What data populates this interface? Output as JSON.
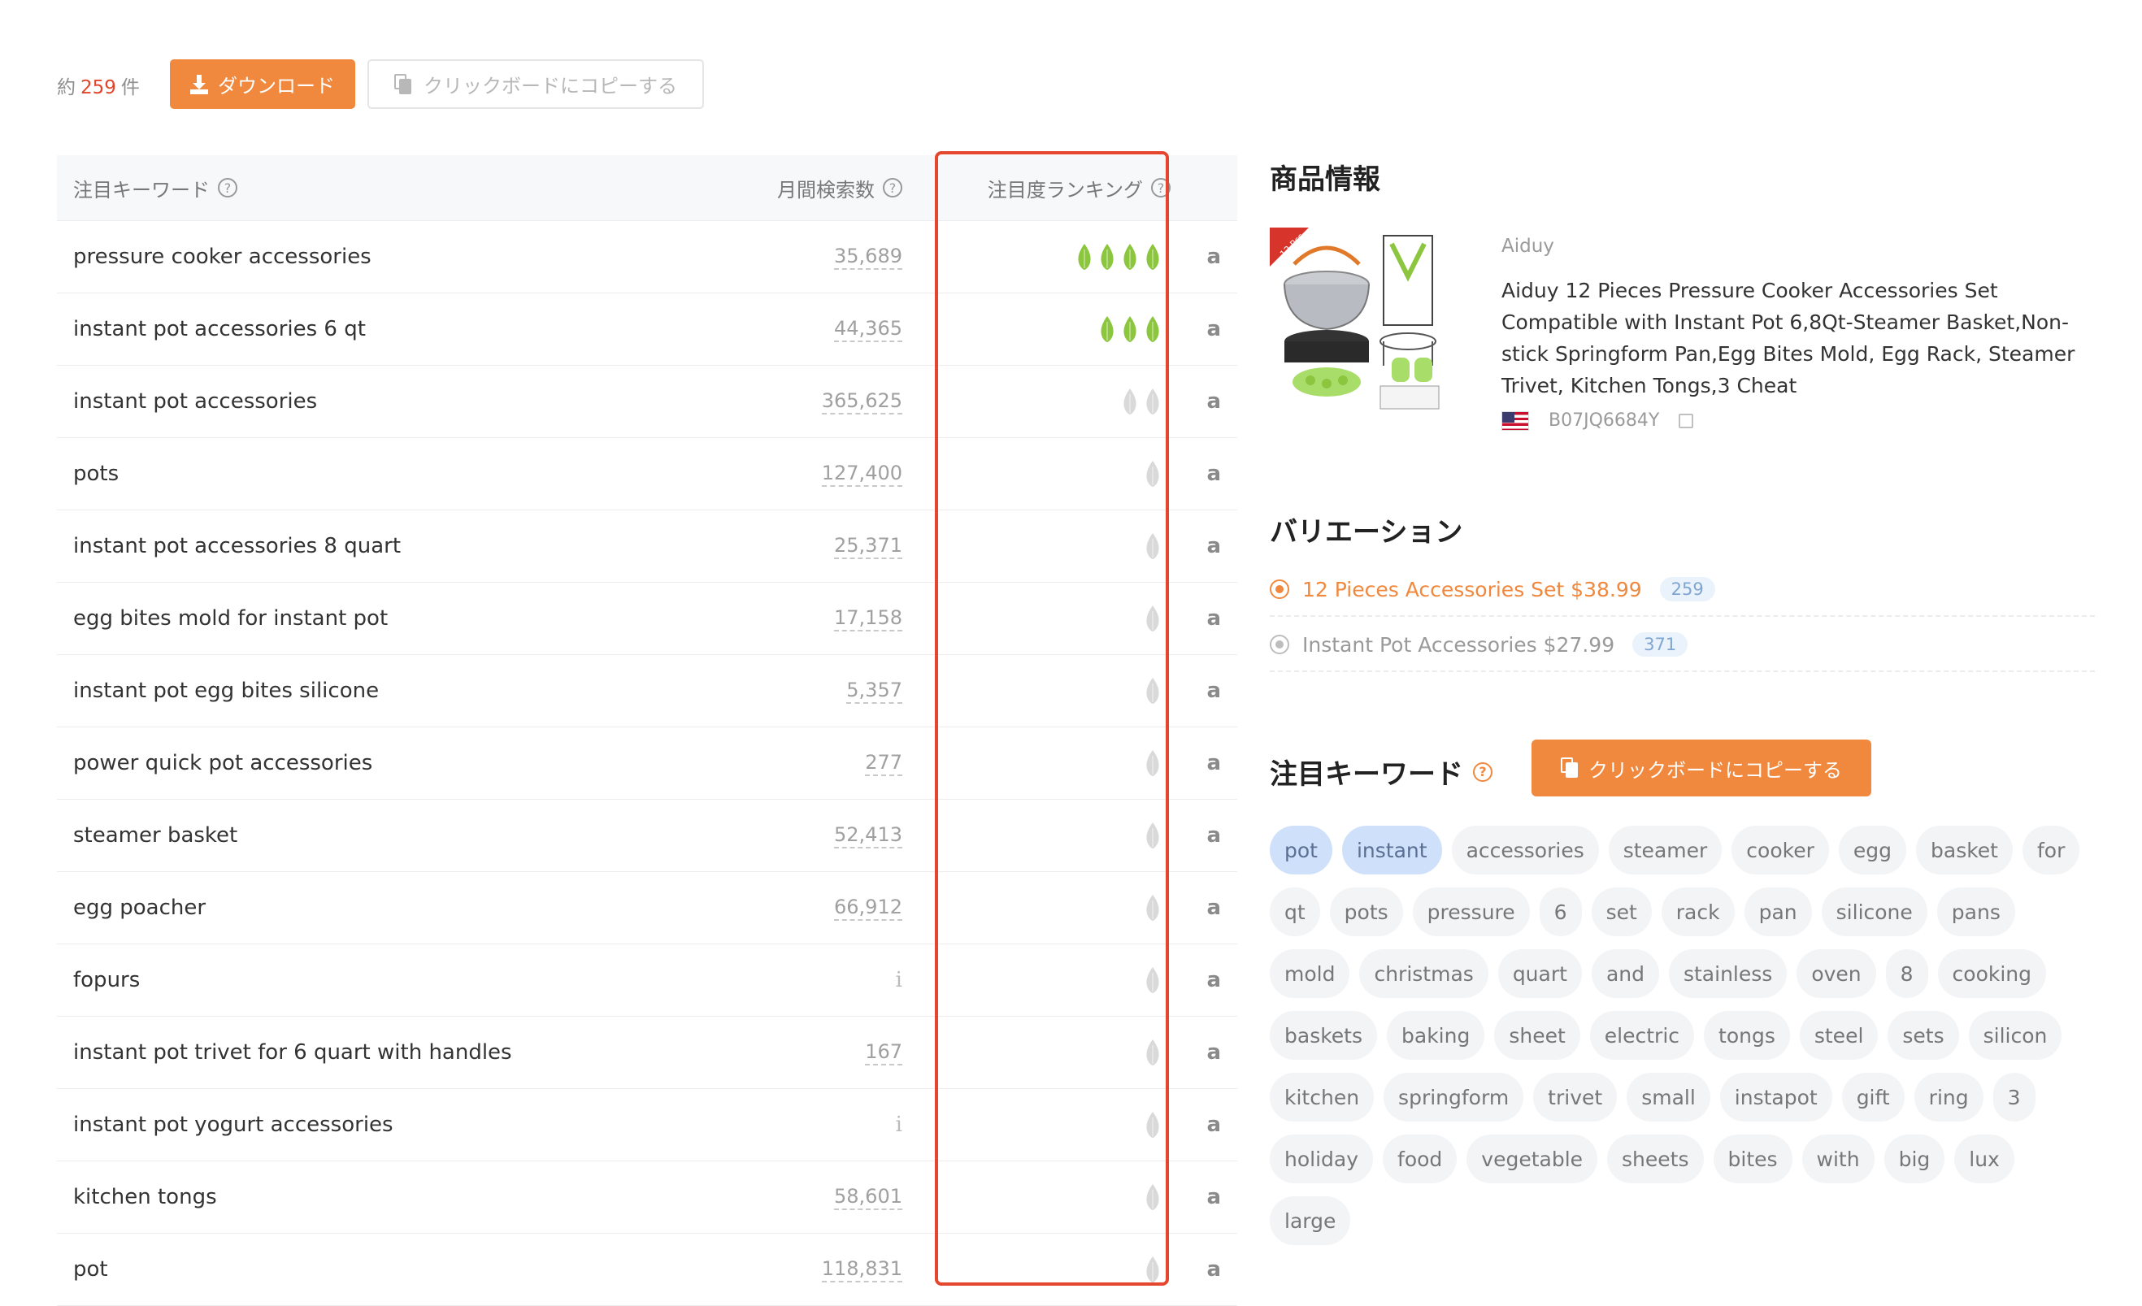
{
  "toolbar": {
    "count_prefix": "約",
    "count_value": "259",
    "count_suffix": "件",
    "download_label": "ダウンロード",
    "copy_label": "クリックボードにコピーする"
  },
  "table": {
    "headers": {
      "keyword": "注目キーワード",
      "volume": "月間検索数",
      "ranking": "注目度ランキング"
    },
    "rows": [
      {
        "keyword": "pressure cooker accessories",
        "volume": "35,689",
        "leaves": 4,
        "leaf_color": "green"
      },
      {
        "keyword": "instant pot accessories 6 qt",
        "volume": "44,365",
        "leaves": 3,
        "leaf_color": "green"
      },
      {
        "keyword": "instant pot accessories",
        "volume": "365,625",
        "leaves": 2,
        "leaf_color": "gray"
      },
      {
        "keyword": "pots",
        "volume": "127,400",
        "leaves": 1,
        "leaf_color": "gray"
      },
      {
        "keyword": "instant pot accessories 8 quart",
        "volume": "25,371",
        "leaves": 1,
        "leaf_color": "gray"
      },
      {
        "keyword": "egg bites mold for instant pot",
        "volume": "17,158",
        "leaves": 1,
        "leaf_color": "gray"
      },
      {
        "keyword": "instant pot egg bites silicone",
        "volume": "5,357",
        "leaves": 1,
        "leaf_color": "gray"
      },
      {
        "keyword": "power quick pot accessories",
        "volume": "277",
        "leaves": 1,
        "leaf_color": "gray"
      },
      {
        "keyword": "steamer basket",
        "volume": "52,413",
        "leaves": 1,
        "leaf_color": "gray"
      },
      {
        "keyword": "egg poacher",
        "volume": "66,912",
        "leaves": 1,
        "leaf_color": "gray"
      },
      {
        "keyword": "fopurs",
        "volume": "i",
        "leaves": 1,
        "leaf_color": "gray"
      },
      {
        "keyword": "instant pot trivet for 6 quart with handles",
        "volume": "167",
        "leaves": 1,
        "leaf_color": "gray"
      },
      {
        "keyword": "instant pot yogurt accessories",
        "volume": "i",
        "leaves": 1,
        "leaf_color": "gray"
      },
      {
        "keyword": "kitchen tongs",
        "volume": "58,601",
        "leaves": 1,
        "leaf_color": "gray"
      },
      {
        "keyword": "pot",
        "volume": "118,831",
        "leaves": 1,
        "leaf_color": "gray"
      }
    ]
  },
  "product": {
    "heading": "商品情報",
    "image_badge": "12 Pcs",
    "brand": "Aiduy",
    "title": "Aiduy 12 Pieces Pressure Cooker Accessories Set Compatible with Instant Pot 6,8Qt-Steamer Basket,Non-stick Springform Pan,Egg Bites Mold, Egg Rack, Steamer Trivet, Kitchen Tongs,3 Cheat",
    "asin": "B07JQ6684Y"
  },
  "variation": {
    "heading": "バリエーション",
    "items": [
      {
        "label": "12 Pieces Accessories Set $38.99",
        "count": "259",
        "selected": true
      },
      {
        "label": "Instant Pot Accessories $27.99",
        "count": "371",
        "selected": false
      }
    ]
  },
  "keywords_panel": {
    "heading": "注目キーワード",
    "copy_label": "クリックボードにコピーする",
    "tags": [
      {
        "text": "pot",
        "selected": true
      },
      {
        "text": "instant",
        "selected": true
      },
      {
        "text": "accessories"
      },
      {
        "text": "steamer"
      },
      {
        "text": "cooker"
      },
      {
        "text": "egg"
      },
      {
        "text": "basket"
      },
      {
        "text": "for"
      },
      {
        "text": "qt"
      },
      {
        "text": "pots"
      },
      {
        "text": "pressure"
      },
      {
        "text": "6"
      },
      {
        "text": "set"
      },
      {
        "text": "rack"
      },
      {
        "text": "pan"
      },
      {
        "text": "silicone"
      },
      {
        "text": "pans"
      },
      {
        "text": "mold"
      },
      {
        "text": "christmas"
      },
      {
        "text": "quart"
      },
      {
        "text": "and"
      },
      {
        "text": "stainless"
      },
      {
        "text": "oven"
      },
      {
        "text": "8"
      },
      {
        "text": "cooking"
      },
      {
        "text": "baskets"
      },
      {
        "text": "baking"
      },
      {
        "text": "sheet"
      },
      {
        "text": "electric"
      },
      {
        "text": "tongs"
      },
      {
        "text": "steel"
      },
      {
        "text": "sets"
      },
      {
        "text": "silicon"
      },
      {
        "text": "kitchen"
      },
      {
        "text": "springform"
      },
      {
        "text": "trivet"
      },
      {
        "text": "small"
      },
      {
        "text": "instapot"
      },
      {
        "text": "gift"
      },
      {
        "text": "ring"
      },
      {
        "text": "3"
      },
      {
        "text": "holiday"
      },
      {
        "text": "food"
      },
      {
        "text": "vegetable"
      },
      {
        "text": "sheets"
      },
      {
        "text": "bites"
      },
      {
        "text": "with"
      },
      {
        "text": "big"
      },
      {
        "text": "lux"
      },
      {
        "text": "large"
      }
    ]
  },
  "colors": {
    "accent": "#f0883e",
    "highlight": "#e5472e",
    "leaf_green": "#8cc63f",
    "leaf_gray": "#d9d9d9",
    "tag_selected": "#cfe0fb"
  }
}
